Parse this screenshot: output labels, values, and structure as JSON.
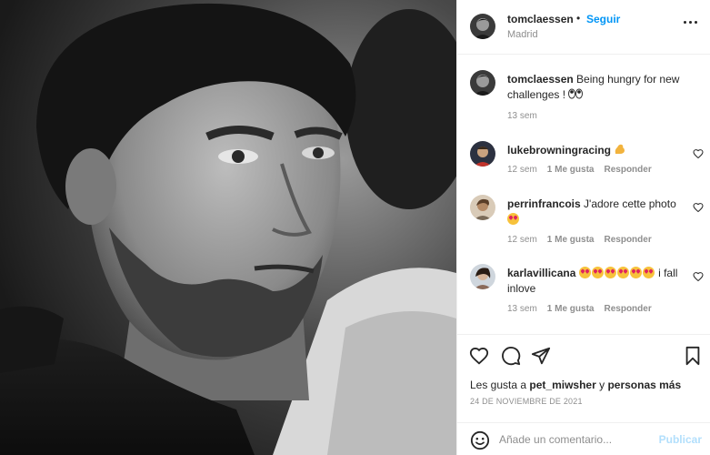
{
  "header": {
    "username": "tomclaessen",
    "dot": "•",
    "follow_label": "Seguir",
    "location": "Madrid"
  },
  "caption": {
    "username": "tomclaessen",
    "text": "Being hungry for new challenges !",
    "emoji": "eyes-emoji",
    "age": "13 sem"
  },
  "comments": [
    {
      "username": "lukebrowningracing",
      "text": "",
      "emoji": "flexed-biceps-emoji",
      "age": "12 sem",
      "likes": "1 Me gusta",
      "reply": "Responder"
    },
    {
      "username": "perrinfrancois",
      "text": "J'adore cette photo",
      "emoji": "heart-eyes-emoji",
      "age": "12 sem",
      "likes": "1 Me gusta",
      "reply": "Responder"
    },
    {
      "username": "karlavillicana",
      "text_after": "i fall inlove",
      "emoji": "heart-eyes-emoji",
      "emoji_count": 6,
      "age": "13 sem",
      "likes": "1 Me gusta",
      "reply": "Responder"
    }
  ],
  "likes": {
    "prefix": "Les gusta a",
    "user": "pet_miwsher",
    "middle": "y",
    "suffix": "personas más"
  },
  "date": "24 de noviembre de 2021",
  "add_comment": {
    "placeholder": "Añade un comentario...",
    "publish_label": "Publicar"
  },
  "icons": {
    "like": "heart-icon",
    "comment": "comment-icon",
    "share": "paper-plane-icon",
    "save": "bookmark-icon",
    "emoji": "smiley-icon",
    "more": "more-options-icon"
  },
  "colors": {
    "accent": "#0095f6",
    "muted": "#8e8e8e",
    "text": "#262626",
    "publish_disabled": "#b2dffc"
  }
}
